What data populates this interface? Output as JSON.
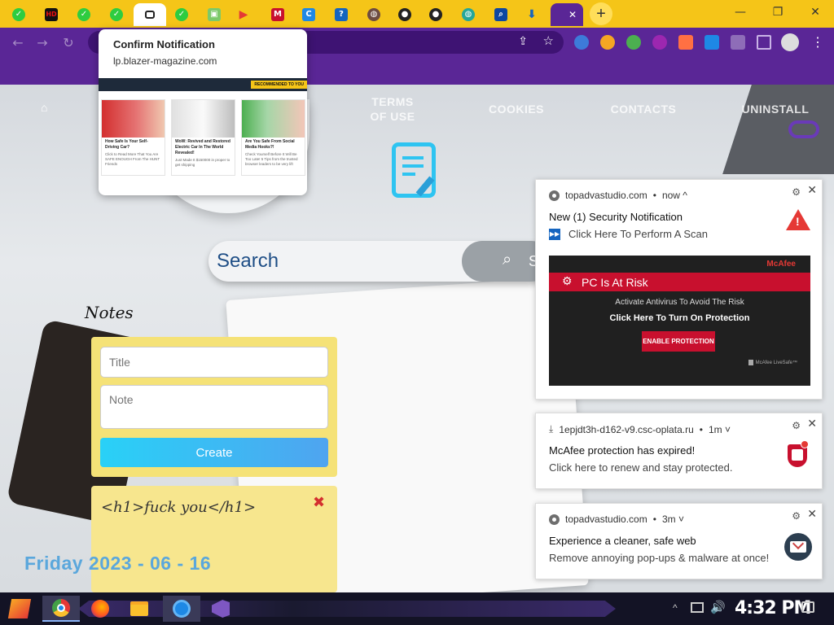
{
  "browser": {
    "new_tab_symbol": "+",
    "window_controls": {
      "minimize": "—",
      "restore": "❐",
      "close": "✕"
    },
    "tabs": [
      {
        "icon": "green-check-icon"
      },
      {
        "icon": "hd-icon"
      },
      {
        "icon": "green-check-icon"
      },
      {
        "icon": "green-check-icon"
      },
      {
        "icon": "home-icon"
      },
      {
        "icon": "green-check-icon"
      },
      {
        "icon": "shield-icon"
      },
      {
        "icon": "play-icon"
      },
      {
        "icon": "mcafee-icon"
      },
      {
        "icon": "letter-c-icon"
      },
      {
        "icon": "question-icon"
      },
      {
        "icon": "globe-icon"
      },
      {
        "icon": "github-icon"
      },
      {
        "icon": "github-icon"
      },
      {
        "icon": "globe-icon"
      },
      {
        "icon": "search-icon"
      },
      {
        "icon": "download-icon"
      },
      {
        "icon": "active-tab-icon"
      }
    ],
    "active_tab_close": "✕"
  },
  "site": {
    "nav": [
      {
        "label_line1": "TERMS",
        "label_line2": "OF USE"
      },
      {
        "label": "COOKIES"
      },
      {
        "label": "CONTACTS"
      },
      {
        "label": "UNINSTALL"
      }
    ],
    "search": {
      "placeholder": "Search",
      "button_text": "S"
    },
    "notes_heading": "Notes",
    "notes_form": {
      "title_placeholder": "Title",
      "note_placeholder": "Note",
      "create_label": "Create"
    },
    "note_card": {
      "text": "<h1>fuck you</h1>",
      "delete_symbol": "✖"
    },
    "date": "Friday 2023 - 06 - 16"
  },
  "confirm_popup": {
    "title": "Confirm Notification",
    "domain": "lp.blazer-magazine.com",
    "banner_label": "RECOMMENDED TO YOU",
    "cards": [
      {
        "title": "How Safe Is Your Self-Driving Car?",
        "desc": "Click to Read More That You Are SAFE ENOUGH From The HUNT Friends"
      },
      {
        "title": "WoW: Revived and Restored Electric Car In The World Revealed!",
        "desc": "Just Made It $150000 in proper to get shipping"
      },
      {
        "title": "Are You Safe From Social Media Hooks?!",
        "desc": "Check Yourself Before It Will Be Too Late! 5 Tips from the trusted browser leaders to be very lift"
      }
    ]
  },
  "notifications": [
    {
      "source": "topadvastudio.com",
      "time": "now ^",
      "title": "New (1) Security Notification",
      "body": "Click Here To Perform A Scan",
      "ad": {
        "brand": "McAfee",
        "headline": "PC Is At Risk",
        "line1": "Activate Antivirus To Avoid The Risk",
        "line2": "Click Here To Turn On Protection",
        "button": "ENABLE PROTECTION",
        "footer": "McAfee LiveSafe™"
      }
    },
    {
      "source": "1epjdt3h-d162-v9.csc-oplata.ru",
      "time": "1m ˅",
      "title": "McAfee protection has expired!",
      "body": "Click here to renew and stay protected."
    },
    {
      "source": "topadvastudio.com",
      "time": "3m ˅",
      "title": "Experience a cleaner, safe web",
      "body": "Remove annoying pop-ups & malware at once!"
    }
  ],
  "notification_controls": {
    "bullet": "•",
    "settings": "⚙",
    "close": "✕"
  },
  "taskbar": {
    "clock": "4:32 PM",
    "apps": [
      "chrome-icon",
      "firefox-icon",
      "file-explorer-icon",
      "ie-icon",
      "visual-studio-icon"
    ]
  },
  "colors": {
    "tab_strip": "#f5c518",
    "toolbar": "#5a2696",
    "notes_yellow": "#f5e277",
    "create_button": "#29d1f7",
    "date_blue": "#5aa7dc",
    "mcafee_red": "#c8102e"
  }
}
